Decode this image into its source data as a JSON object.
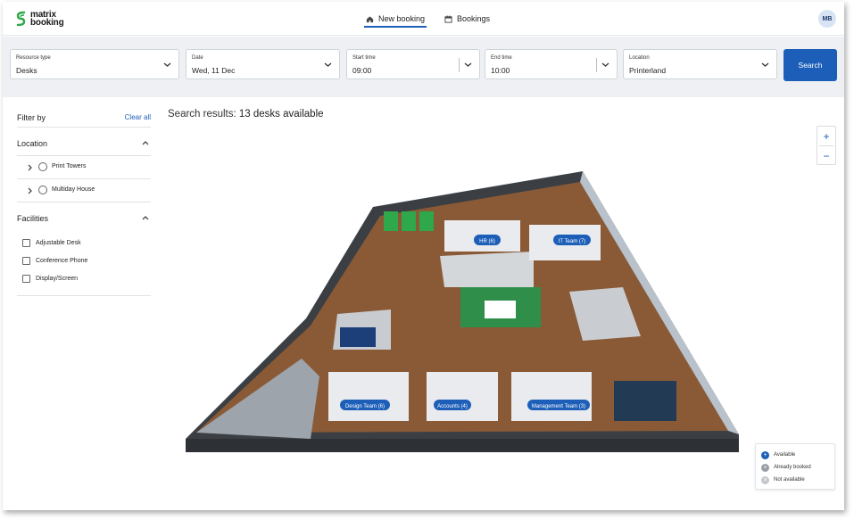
{
  "header": {
    "logo_line1": "matrix",
    "logo_line2": "booking",
    "nav": [
      {
        "label": "New booking",
        "icon": "home-icon",
        "active": true
      },
      {
        "label": "Bookings",
        "icon": "calendar-icon",
        "active": false
      }
    ],
    "avatar_initials": "MB"
  },
  "search": {
    "resource_type": {
      "label": "Resource type",
      "value": "Desks"
    },
    "date": {
      "label": "Date",
      "value": "Wed, 11 Dec"
    },
    "start_time": {
      "label": "Start time",
      "value": "09:00"
    },
    "end_time": {
      "label": "End time",
      "value": "10:00"
    },
    "location": {
      "label": "Location",
      "value": "Printerland"
    },
    "button_label": "Search"
  },
  "filters": {
    "title": "Filter by",
    "clear_label": "Clear all",
    "location": {
      "title": "Location",
      "items": [
        {
          "label": "Print Towers"
        },
        {
          "label": "Multiday House"
        }
      ]
    },
    "facilities": {
      "title": "Facilities",
      "items": [
        {
          "label": "Adjustable Desk"
        },
        {
          "label": "Conference Phone"
        },
        {
          "label": "Display/Screen"
        }
      ]
    }
  },
  "results": {
    "prefix": "Search results:",
    "text": "13 desks available"
  },
  "map": {
    "zones": [
      {
        "label": "HR (6)"
      },
      {
        "label": "IT Team (7)"
      },
      {
        "label": "Design Team (6)"
      },
      {
        "label": "Accounts (4)"
      },
      {
        "label": "Management Team (3)"
      }
    ],
    "zoom_in": "+",
    "zoom_out": "−"
  },
  "legend": {
    "items": [
      {
        "label": "Available",
        "color": "#1d5fb8"
      },
      {
        "label": "Already booked",
        "color": "#9aa0a8"
      },
      {
        "label": "Not available",
        "color": "#c4c8cd"
      }
    ]
  },
  "colors": {
    "accent": "#1d5fb8",
    "floor": "#8a5a36",
    "carpet_green": "#2ea84a"
  }
}
